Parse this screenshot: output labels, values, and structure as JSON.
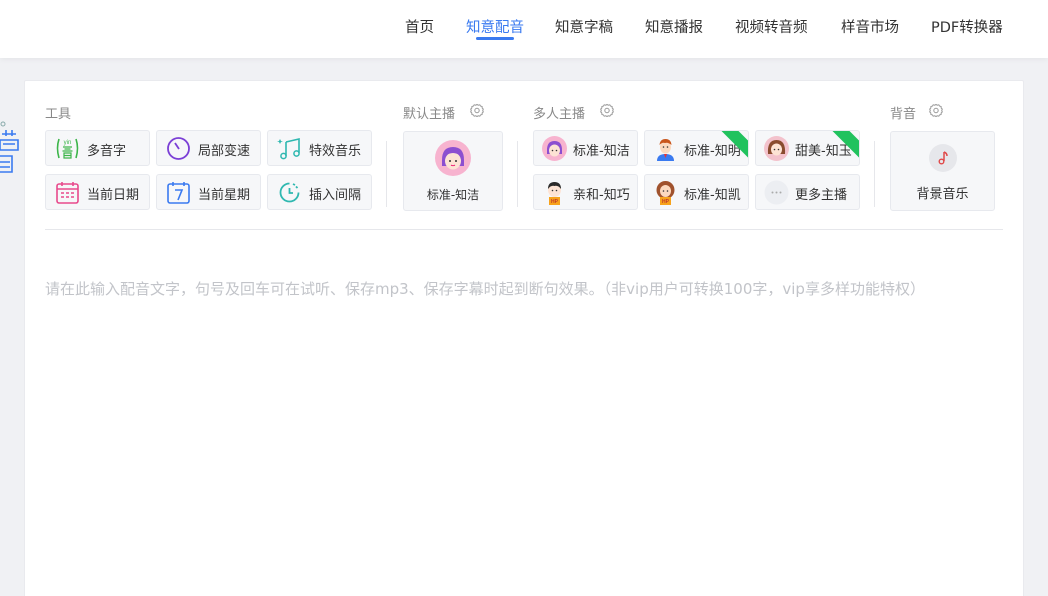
{
  "nav": {
    "items": [
      "首页",
      "知意配音",
      "知意字稿",
      "知意播报",
      "视频转音频",
      "样音市场",
      "PDF转换器"
    ],
    "active": "知意配音"
  },
  "sections": {
    "tools": "工具",
    "default_anchor": "默认主播",
    "multi_anchor": "多人主播",
    "bgm": "背音"
  },
  "tools": [
    {
      "label": "多音字",
      "icon": "polyphone-icon"
    },
    {
      "label": "局部变速",
      "icon": "speed-dial-icon"
    },
    {
      "label": "特效音乐",
      "icon": "music-note-icon"
    },
    {
      "label": "当前日期",
      "icon": "calendar-icon"
    },
    {
      "label": "当前星期",
      "icon": "week-calendar-icon"
    },
    {
      "label": "插入间隔",
      "icon": "pause-timer-icon"
    }
  ],
  "default_anchor": {
    "label": "标准-知洁",
    "icon": "girl-avatar-icon"
  },
  "anchors": [
    {
      "label": "标准-知洁",
      "icon": "girl-avatar-icon",
      "badge": false
    },
    {
      "label": "标准-知明",
      "icon": "man-avatar-icon",
      "badge": true
    },
    {
      "label": "甜美-知玉",
      "icon": "woman-avatar-icon",
      "badge": true
    },
    {
      "label": "亲和-知巧",
      "icon": "child-avatar-icon",
      "badge": false
    },
    {
      "label": "标准-知凯",
      "icon": "boy-avatar-icon",
      "badge": false
    },
    {
      "label": "更多主播",
      "icon": "more-icon",
      "badge": false
    }
  ],
  "bgm": {
    "label": "背景音乐",
    "icon": "music-note-icon"
  },
  "editor": {
    "placeholder": "请在此输入配音文字，句号及回车可在试听、保存mp3、保存字幕时起到断句效果。（非vip用户可转换100字，vip享多样功能特权）"
  },
  "colors": {
    "accent": "#3a7af0",
    "badge": "#21c25e",
    "placeholder": "#c2c4c9"
  }
}
